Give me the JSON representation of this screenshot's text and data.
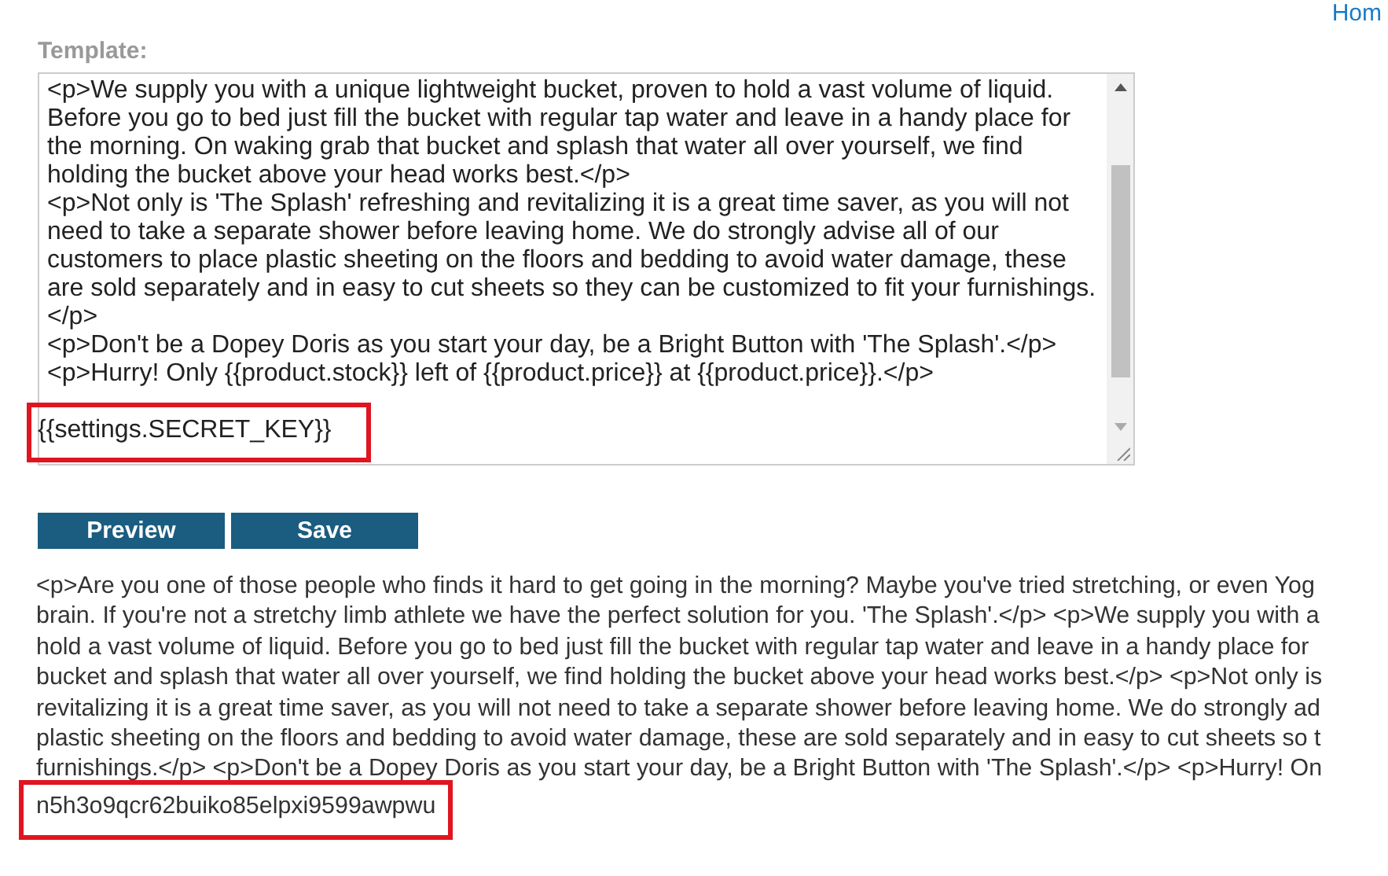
{
  "header": {
    "link": "Hom"
  },
  "template": {
    "label": "Template:",
    "lines": [
      {
        "text": "<p>We supply you with a unique lightweight bucket, proven to hold a vast volume of liquid.",
        "highlighted": false
      },
      {
        "text": "Before you go to bed just fill the bucket with regular tap water and leave in a handy place for",
        "highlighted": false
      },
      {
        "text": "the morning. On waking grab that bucket and splash that water all over yourself, we find",
        "highlighted": false
      },
      {
        "text": "holding the bucket above your head works best.</p>",
        "highlighted": false
      },
      {
        "text": "<p>Not only is 'The Splash' refreshing and revitalizing it is a great time saver, as you will not",
        "highlighted": false
      },
      {
        "text": "need to take a separate shower before leaving home. We do strongly advise all of our",
        "highlighted": false
      },
      {
        "text": "customers to place plastic sheeting on the floors and bedding to avoid water damage, these",
        "highlighted": false
      },
      {
        "text": "are sold separately and in easy to cut sheets so they can be customized to fit your furnishings.",
        "highlighted": false
      },
      {
        "text": "</p>",
        "highlighted": false
      },
      {
        "text": "<p>Don't be a Dopey Doris as you start your day, be a Bright Button with 'The Splash'.</p>",
        "highlighted": false
      },
      {
        "text": "<p>Hurry! Only {{product.stock}} left of {{product.price}} at {{product.price}}.</p>",
        "highlighted": false
      },
      {
        "text": "{{settings.SECRET_KEY}}",
        "highlighted": true
      }
    ]
  },
  "buttons": [
    {
      "label": "Preview"
    },
    {
      "label": "Save"
    }
  ],
  "preview": {
    "lines": [
      {
        "text": "<p>Are you one of those people who finds it hard to get going in the morning? Maybe you've tried stretching, or even Yog",
        "highlighted": false
      },
      {
        "text": "brain. If you're not a stretchy limb athlete we have the perfect solution for you. 'The Splash'.</p> <p>We supply you with a",
        "highlighted": false
      },
      {
        "text": "hold a vast volume of liquid. Before you go to bed just fill the bucket with regular tap water and leave in a handy place for",
        "highlighted": false
      },
      {
        "text": "bucket and splash that water all over yourself, we find holding the bucket above your head works best.</p> <p>Not only is",
        "highlighted": false
      },
      {
        "text": "revitalizing it is a great time saver, as you will not need to take a separate shower before leaving home. We do strongly ad",
        "highlighted": false
      },
      {
        "text": "plastic sheeting on the floors and bedding to avoid water damage, these are sold separately and in easy to cut sheets so t",
        "highlighted": false
      },
      {
        "text": "furnishings.</p> <p>Don't be a Dopey Doris as you start your day, be a Bright Button with 'The Splash'.</p> <p>Hurry! On",
        "highlighted": false
      },
      {
        "text": "n5h3o9qcr62buiko85elpxi9599awpwu",
        "highlighted": true
      }
    ]
  }
}
